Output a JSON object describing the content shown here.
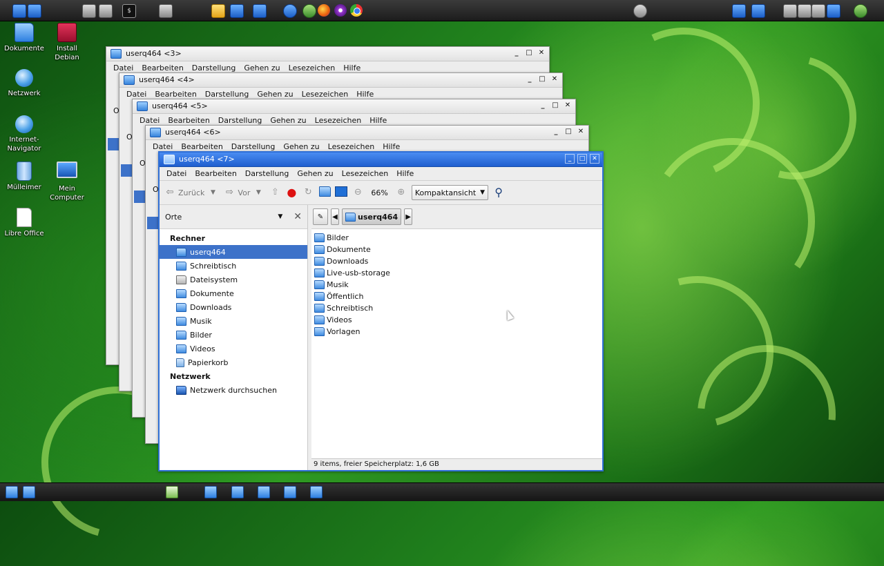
{
  "desktop": {
    "icons": [
      {
        "label": "Dokumente"
      },
      {
        "label": "Install Debian"
      },
      {
        "label": "Netzwerk"
      },
      {
        "label": "Internet-Navigator"
      },
      {
        "label": "Mülleimer"
      },
      {
        "label": "Mein Computer"
      },
      {
        "label": "Libre Office"
      }
    ]
  },
  "menu_labels": [
    "Datei",
    "Bearbeiten",
    "Darstellung",
    "Gehen zu",
    "Lesezeichen",
    "Hilfe"
  ],
  "back_windows": [
    {
      "title": "userq464 <3>"
    },
    {
      "title": "userq464 <4>"
    },
    {
      "title": "userq464 <5>"
    },
    {
      "title": "userq464 <6>"
    }
  ],
  "back_window_partial_text": "O",
  "window": {
    "title": "userq464 <7>",
    "buttons": {
      "minimize": "_",
      "maximize": "□",
      "close": "✕"
    },
    "toolbar": {
      "back_label": "Zurück",
      "forward_label": "Vor",
      "zoom": "66%",
      "view_mode": "Kompaktansicht"
    },
    "sidebar": {
      "header": "Orte",
      "groups": [
        {
          "title": "Rechner",
          "items": [
            "userq464",
            "Schreibtisch",
            "Dateisystem",
            "Dokumente",
            "Downloads",
            "Musik",
            "Bilder",
            "Videos",
            "Papierkorb"
          ]
        },
        {
          "title": "Netzwerk",
          "items": [
            "Netzwerk durchsuchen"
          ]
        }
      ],
      "selected": "userq464"
    },
    "path": {
      "current": "userq464"
    },
    "files": [
      "Bilder",
      "Dokumente",
      "Downloads",
      "Live-usb-storage",
      "Musik",
      "Öffentlich",
      "Schreibtisch",
      "Videos",
      "Vorlagen"
    ],
    "status": "9 items, freier Speicherplatz: 1,6 GB"
  },
  "icons": {
    "panel_left": [
      "start-menu-icon",
      "files-icon",
      "network-places-icon",
      "settings-tools-icon",
      "terminal-icon",
      "text-editor-icon",
      "folder-icon",
      "file-manager-icon",
      "file-manager-2-icon",
      "system-config-icon",
      "browser-icon",
      "firefox-icon",
      "tor-icon",
      "chromium-icon"
    ],
    "panel_right": [
      "network-manager-icon",
      "display-icon",
      "screen-icon",
      "volume-icon",
      "battery-icon",
      "clock-icon"
    ]
  },
  "colors": {
    "titlebar_active": "#2f6fd6",
    "selection": "#3d72c9"
  }
}
